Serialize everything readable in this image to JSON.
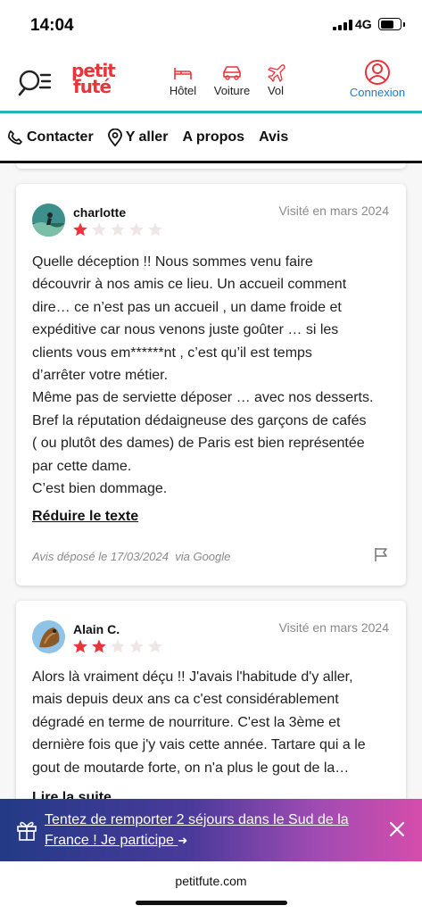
{
  "status_bar": {
    "time": "14:04",
    "network": "4G",
    "icons": [
      "signal-icon",
      "battery-icon"
    ]
  },
  "header": {
    "logo": {
      "line1": "petit",
      "line2": "futé"
    },
    "menu_search_icon": "menu-search-icon",
    "nav": [
      {
        "label": "Hôtel",
        "icon": "bed-icon"
      },
      {
        "label": "Voiture",
        "icon": "car-icon"
      },
      {
        "label": "Vol",
        "icon": "plane-icon"
      }
    ],
    "login": {
      "label": "Connexion",
      "icon": "user-circle-icon"
    },
    "accent_color": "#1fb6b6",
    "brand_color": "#e8343a"
  },
  "tabs": [
    {
      "label": "Contacter",
      "icon": "phone-icon"
    },
    {
      "label": "Y aller",
      "icon": "map-pin-icon"
    },
    {
      "label": "A propos"
    },
    {
      "label": "Avis"
    }
  ],
  "reviews": [
    {
      "author": "charlotte",
      "visited": "Visité en mars 2024",
      "rating": 1,
      "max_rating": 5,
      "lines": [
        "Quelle déception !! Nous sommes venu faire",
        "découvrir à nos amis ce lieu. Un accueil comment",
        "dire… ce n’est pas un accueil , un dame froide et",
        "expéditive car nous venons juste goûter … si les",
        "clients vous em******nt , c’est qu’il est temps",
        "d’arrêter votre métier.",
        "Même pas de serviette déposer … avec nos desserts.",
        "Bref la réputation dédaigneuse des garçons de cafés",
        "( ou plutôt des dames) de Paris est bien représentée",
        "par cette dame.",
        "C’est bien dommage."
      ],
      "toggle_label": "Réduire le texte",
      "deposited": "Avis déposé le 17/03/2024",
      "source": "via Google",
      "flag_icon": "flag-icon"
    },
    {
      "author": "Alain C.",
      "visited": "Visité en mars 2024",
      "rating": 2,
      "max_rating": 5,
      "lines": [
        "Alors là vraiment déçu !! J'avais l'habitude d'y aller,",
        "mais depuis deux ans ca c'est considérablement",
        "dégradé en terme de nourriture. C'est la 3ème et",
        "dernière fois que j'y vais cette année. Tartare qui a le",
        "gout de moutarde forte, on n'a plus le gout de la…"
      ],
      "toggle_label": "Lire la suite"
    }
  ],
  "star_color": "#e8343a",
  "promo": {
    "text": "Tentez de remporter 2 séjours dans le Sud de la France ! Je participe",
    "gift_icon": "gift-icon",
    "arrow_icon": "arrow-right-icon",
    "close_icon": "close-icon"
  },
  "browser": {
    "url": "petitfute.com"
  }
}
